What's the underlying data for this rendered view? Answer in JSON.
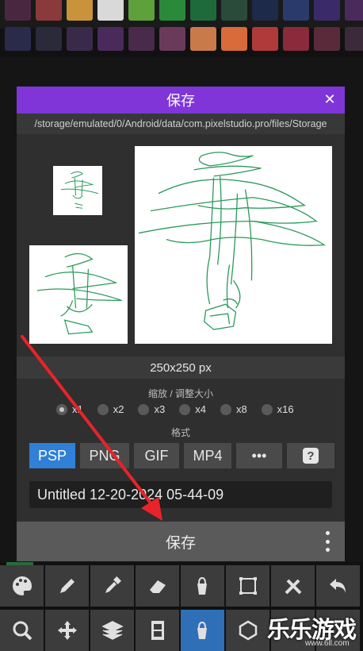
{
  "palette": {
    "row1": [
      "#4a2740",
      "#8a3a3a",
      "#c8933a",
      "#d9d9d9",
      "#5ea03a",
      "#2a8a3a",
      "#1f6a3a",
      "#2a4a3a",
      "#1e2a4a",
      "#2a3a6a",
      "#3a2a6a",
      "#4a2a5a"
    ],
    "row2": [
      "#2a2a4a",
      "#2a2a3a",
      "#3a2a4a",
      "#4a2a5a",
      "#4a2a4a",
      "#6a3a5a",
      "#c87a4a",
      "#d96a3a",
      "#b03a3a",
      "#8a2a3a",
      "#5a2a3a",
      "#3a2a3a"
    ]
  },
  "dialog": {
    "title": "保存",
    "close_icon": "close-icon",
    "path": "/storage/emulated/0/Android/data/com.pixelstudio.pro/files/Storage",
    "size_text": "250x250 px",
    "scale_label": "缩放 / 调整大小",
    "scale_options": [
      "x1",
      "x2",
      "x3",
      "x4",
      "x8",
      "x16"
    ],
    "scale_selected": "x1",
    "format_label": "格式",
    "formats": [
      "PSP",
      "PNG",
      "GIF",
      "MP4",
      "•••",
      "?"
    ],
    "format_selected": "PSP",
    "filename": "Untitled 12-20-2024 05-44-09",
    "save_label": "保存",
    "more_icon": "more-vertical-icon"
  },
  "toolbar_row1": [
    "palette-icon",
    "pencil-icon",
    "eyedropper-icon",
    "eraser-icon",
    "bucket-icon",
    "select-rect-icon",
    "tools-icon",
    "undo-icon"
  ],
  "toolbar_row2": [
    "zoom-icon",
    "move-icon",
    "layers-icon",
    "film-icon",
    "bucket-active-icon",
    "hexagon-icon",
    "",
    ""
  ],
  "watermark": {
    "main": "乐乐游戏",
    "sub": "www.6ll.com"
  },
  "colors": {
    "header": "#7f35d8",
    "accent": "#2f80d6",
    "arrow": "#e8232a",
    "drawing": "#2a9a5a"
  }
}
